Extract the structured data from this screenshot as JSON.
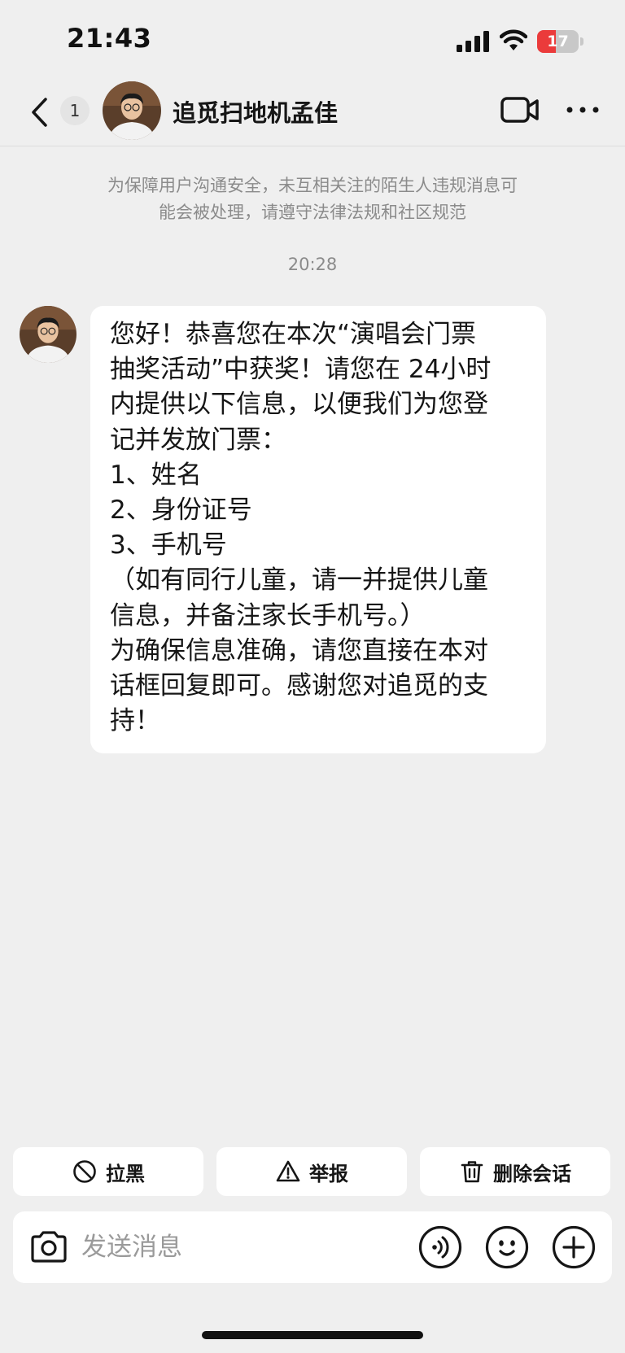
{
  "status_bar": {
    "time": "21:43",
    "battery_level": "17",
    "battery_fraction": 0.17,
    "icons": [
      "signal-icon",
      "wifi-icon",
      "battery-icon"
    ]
  },
  "header": {
    "unread_count": "1",
    "contact_name": "追觅扫地机孟佳",
    "icons": [
      "back-chevron-icon",
      "video-camera-icon",
      "more-dots-icon"
    ]
  },
  "chat": {
    "safety_notice": "为保障用户沟通安全，未互相关注的陌生人违规消息可能会被处理，请遵守法律法规和社区规范",
    "safety_notice_lines": [
      "为保障用户沟通安全，未互相关注的陌生人违规消息可",
      "能会被处理，请遵守法律法规和社区规范"
    ],
    "timestamp": "20:28",
    "message": {
      "lines": [
        "您好！恭喜您在本次“演唱会门票",
        "抽奖活动”中获奖！请您在 24小时",
        "内提供以下信息，以便我们为您登",
        "记并发放门票：",
        "1、姓名",
        "2、身份证号",
        "3、手机号",
        "（如有同行儿童，请一并提供儿童",
        "信息，并备注家长手机号。）",
        "为确保信息准确，请您直接在本对",
        "话框回复即可。感谢您对追觅的支",
        "持！"
      ]
    }
  },
  "actions": {
    "block_label": "拉黑",
    "report_label": "举报",
    "delete_label": "删除会话"
  },
  "input_bar": {
    "placeholder": "发送消息",
    "icons": [
      "camera-icon",
      "voice-icon",
      "emoji-icon",
      "plus-icon"
    ]
  },
  "colors": {
    "background": "#efefef",
    "bubble": "#ffffff",
    "battery_low": "#eb3b3b",
    "muted_text": "#8b8b8b"
  }
}
